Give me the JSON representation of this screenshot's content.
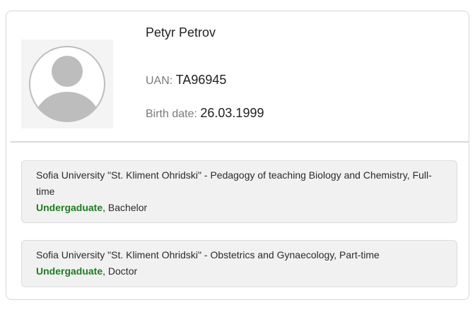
{
  "profile": {
    "name": "Petyr Petrov",
    "uan_label": "UAN:",
    "uan_value": "TA96945",
    "birth_label": "Birth date:",
    "birth_value": "26.03.1999",
    "avatar_icon": "user-avatar-icon"
  },
  "education": [
    {
      "program": "Sofia University \"St. Kliment Ohridski\" - Pedagogy of teaching Biology and Chemistry, Full-time",
      "level": "Undergaduate",
      "separator": ", ",
      "degree": "Bachelor"
    },
    {
      "program": "Sofia University \"St. Kliment Ohridski\" - Obstetrics and Gynaecology, Part-time",
      "level": "Undergaduate",
      "separator": ", ",
      "degree": "Doctor"
    }
  ],
  "colors": {
    "level_green": "#1e7d1e",
    "card_border": "#d6d6d6",
    "item_background": "#f1f1f1",
    "avatar_grey": "#bdbdbd"
  }
}
